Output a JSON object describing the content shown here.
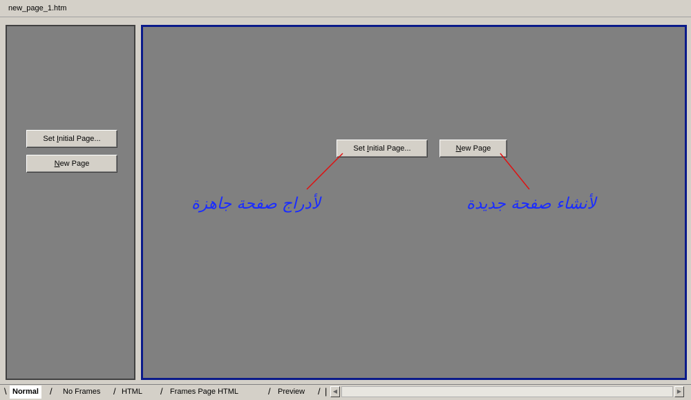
{
  "window": {
    "title": "new_page_1.htm"
  },
  "left_frame": {
    "set_initial_page": {
      "pre": "Set ",
      "mnemonic": "I",
      "post": "nitial Page..."
    },
    "new_page": {
      "pre": "",
      "mnemonic": "N",
      "post": "ew Page"
    }
  },
  "right_frame": {
    "set_initial_page": {
      "pre": "Set ",
      "mnemonic": "I",
      "post": "nitial Page..."
    },
    "new_page": {
      "pre": "",
      "mnemonic": "N",
      "post": "ew Page"
    },
    "annotation_insert": "لأدراج صفحة جاهزة",
    "annotation_new": "لأنشاء صفحة جديدة"
  },
  "tabs": [
    {
      "label": "Normal",
      "active": true
    },
    {
      "label": "No Frames",
      "active": false
    },
    {
      "label": "HTML",
      "active": false
    },
    {
      "label": "Frames Page HTML",
      "active": false
    },
    {
      "label": "Preview",
      "active": false
    }
  ],
  "colors": {
    "frame_bg": "#808080",
    "active_frame_border": "#0a1a8a",
    "annotation_text": "#1a2cff",
    "pointer_line": "#e01010"
  }
}
